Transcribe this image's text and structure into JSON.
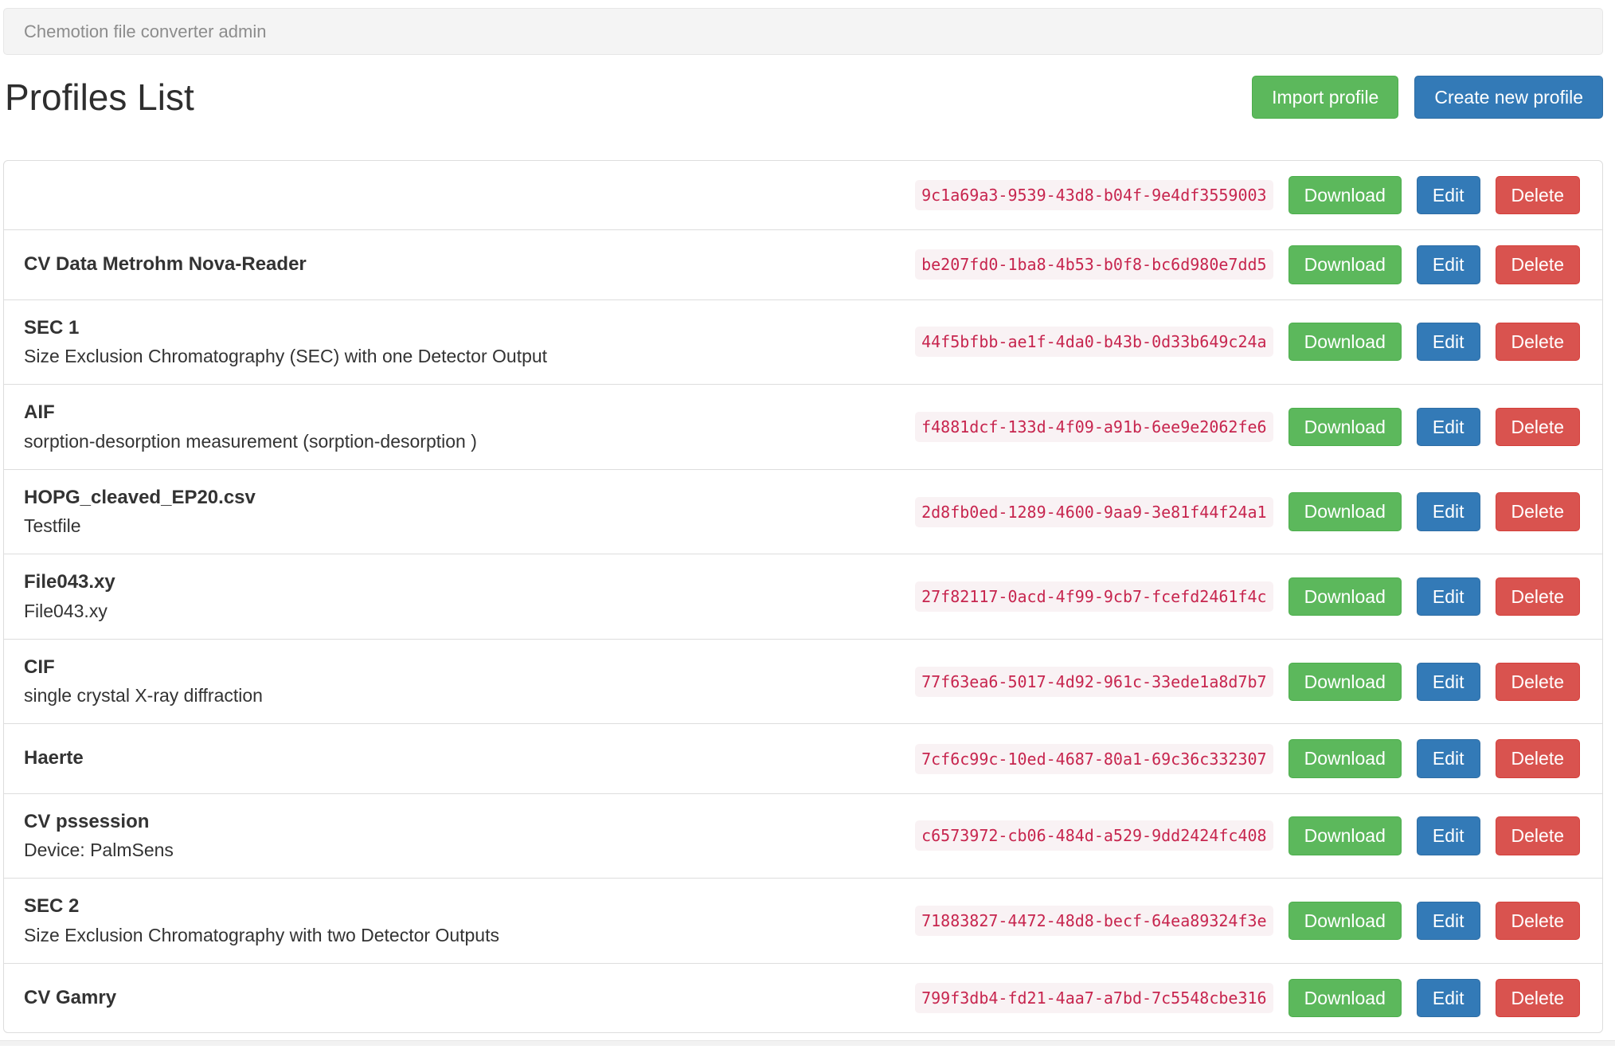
{
  "header": {
    "brand": "Chemotion file converter admin"
  },
  "page": {
    "title": "Profiles List",
    "actions": {
      "import": "Import profile",
      "create": "Create new profile"
    }
  },
  "row_actions": {
    "download": "Download",
    "edit": "Edit",
    "delete": "Delete"
  },
  "colors": {
    "success_green": "#5cb85c",
    "primary_blue": "#337ab7",
    "danger_red": "#d9534f",
    "code_text": "#c7254e",
    "code_background": "#f9f2f4",
    "navbar_background": "#f4f4f4",
    "list_border": "#dddddd"
  },
  "profiles": [
    {
      "title": null,
      "description": null,
      "uuid": "9c1a69a3-9539-43d8-b04f-9e4df3559003"
    },
    {
      "title": "CV Data Metrohm Nova-Reader",
      "description": null,
      "uuid": "be207fd0-1ba8-4b53-b0f8-bc6d980e7dd5"
    },
    {
      "title": "SEC 1",
      "description": "Size Exclusion Chromatography (SEC) with one Detector Output",
      "uuid": "44f5bfbb-ae1f-4da0-b43b-0d33b649c24a"
    },
    {
      "title": "AIF",
      "description": "sorption-desorption measurement (sorption-desorption )",
      "uuid": "f4881dcf-133d-4f09-a91b-6ee9e2062fe6"
    },
    {
      "title": "HOPG_cleaved_EP20.csv",
      "description": "Testfile",
      "uuid": "2d8fb0ed-1289-4600-9aa9-3e81f44f24a1"
    },
    {
      "title": "File043.xy",
      "description": "File043.xy",
      "uuid": "27f82117-0acd-4f99-9cb7-fcefd2461f4c"
    },
    {
      "title": "CIF",
      "description": "single crystal X-ray diffraction",
      "uuid": "77f63ea6-5017-4d92-961c-33ede1a8d7b7"
    },
    {
      "title": "Haerte",
      "description": null,
      "uuid": "7cf6c99c-10ed-4687-80a1-69c36c332307"
    },
    {
      "title": "CV pssession",
      "description": "Device: PalmSens",
      "uuid": "c6573972-cb06-484d-a529-9dd2424fc408"
    },
    {
      "title": "SEC 2",
      "description": "Size Exclusion Chromatography with two Detector Outputs",
      "uuid": "71883827-4472-48d8-becf-64ea89324f3e"
    },
    {
      "title": "CV Gamry",
      "description": null,
      "uuid": "799f3db4-fd21-4aa7-a7bd-7c5548cbe316"
    }
  ]
}
